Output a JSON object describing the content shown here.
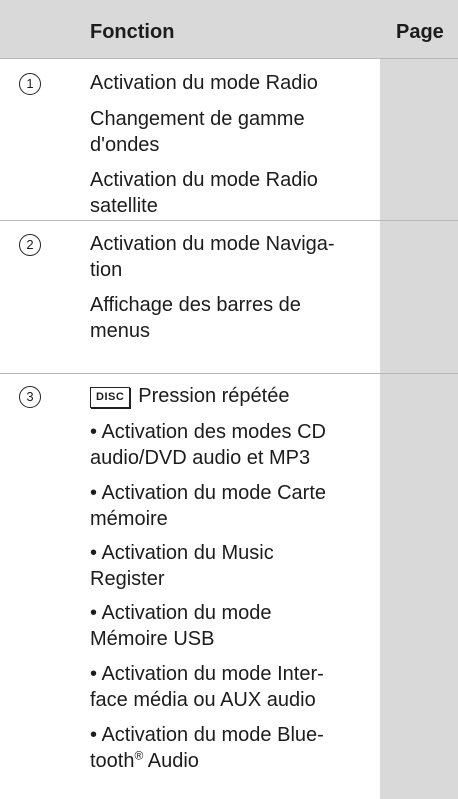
{
  "header": {
    "function": "Fonction",
    "page": "Page"
  },
  "rows": [
    {
      "num": "1",
      "lines": [
        "Activation du mode Radio",
        "Changement de gamme",
        "d'ondes",
        "Activation du mode Radio",
        "satellite"
      ]
    },
    {
      "num": "2",
      "lines": [
        "Activation du mode Naviga-",
        "tion",
        "Affichage des barres de",
        "menus"
      ]
    },
    {
      "num": "3",
      "key": "DISC",
      "key_action": "Pression répétée",
      "lines": [
        "• Activation des modes CD",
        "audio/DVD audio et MP3",
        "• Activation du mode Carte",
        "mémoire",
        "• Activation du Music",
        "Register",
        "• Activation du mode",
        "Mémoire USB",
        "• Activation du mode Inter-",
        "face média ou AUX audio",
        "• Activation du mode Blue-",
        "tooth",
        "®",
        " Audio"
      ]
    }
  ]
}
